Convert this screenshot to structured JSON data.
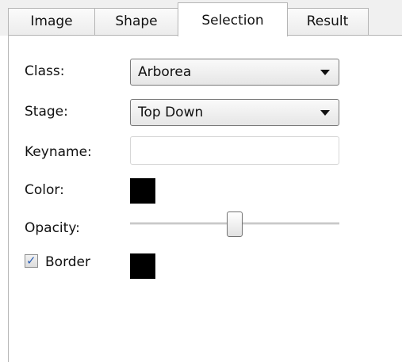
{
  "tabs": [
    {
      "label": "Image",
      "active": false
    },
    {
      "label": "Shape",
      "active": false
    },
    {
      "label": "Selection",
      "active": true
    },
    {
      "label": "Result",
      "active": false
    }
  ],
  "form": {
    "class_label": "Class:",
    "class_value": "Arborea",
    "stage_label": "Stage:",
    "stage_value": "Top Down",
    "keyname_label": "Keyname:",
    "keyname_value": "",
    "color_label": "Color:",
    "color_value": "#000000",
    "opacity_label": "Opacity:",
    "opacity_fraction": 0.5,
    "border_label": "Border",
    "border_checked": true,
    "border_color": "#000000"
  },
  "icons": {
    "dropdown_caret": "chevron-down-icon",
    "check": "checkmark-icon"
  }
}
